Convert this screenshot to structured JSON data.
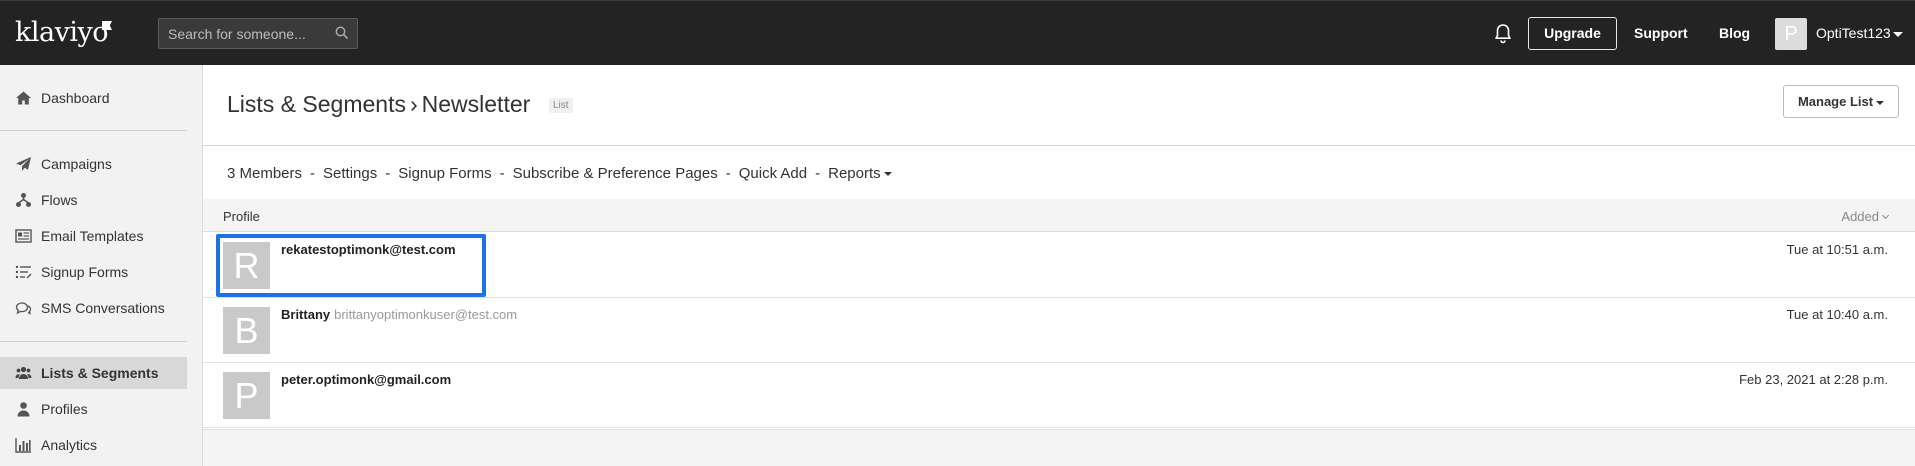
{
  "header": {
    "logo_text": "klaviyo",
    "search_placeholder": "Search for someone...",
    "upgrade_label": "Upgrade",
    "support_label": "Support",
    "blog_label": "Blog",
    "avatar_initial": "P",
    "user_name": "OptiTest123"
  },
  "sidebar": {
    "items": [
      {
        "label": "Dashboard",
        "icon": "home-icon"
      },
      {
        "label": "Campaigns",
        "icon": "paper-plane-icon"
      },
      {
        "label": "Flows",
        "icon": "flows-icon"
      },
      {
        "label": "Email Templates",
        "icon": "template-icon"
      },
      {
        "label": "Signup Forms",
        "icon": "list-icon"
      },
      {
        "label": "SMS Conversations",
        "icon": "chat-icon"
      },
      {
        "label": "Lists & Segments",
        "icon": "users-icon",
        "active": true
      },
      {
        "label": "Profiles",
        "icon": "user-icon"
      },
      {
        "label": "Analytics",
        "icon": "bar-chart-icon"
      }
    ]
  },
  "page": {
    "breadcrumb_parent": "Lists & Segments",
    "breadcrumb_sep": "›",
    "title": "Newsletter",
    "badge": "List",
    "manage_label": "Manage List"
  },
  "subnav": {
    "members": "3 Members",
    "settings": "Settings",
    "signup_forms": "Signup Forms",
    "subscribe_pages": "Subscribe & Preference Pages",
    "quick_add": "Quick Add",
    "reports": "Reports",
    "separator": "-"
  },
  "table": {
    "col_profile": "Profile",
    "col_added": "Added",
    "rows": [
      {
        "initial": "R",
        "name": "rekatestoptimonk@test.com",
        "email": "",
        "added": "Tue at 10:51 a.m."
      },
      {
        "initial": "B",
        "name": "Brittany",
        "email": "brittanyoptimonkuser@test.com",
        "added": "Tue at 10:40 a.m."
      },
      {
        "initial": "P",
        "name": "peter.optimonk@gmail.com",
        "email": "",
        "added": "Feb 23, 2021 at 2:28 p.m."
      }
    ]
  },
  "colors": {
    "topbar": "#232323",
    "sidebar": "#f2f2f2",
    "highlight": "#1a73e8"
  }
}
